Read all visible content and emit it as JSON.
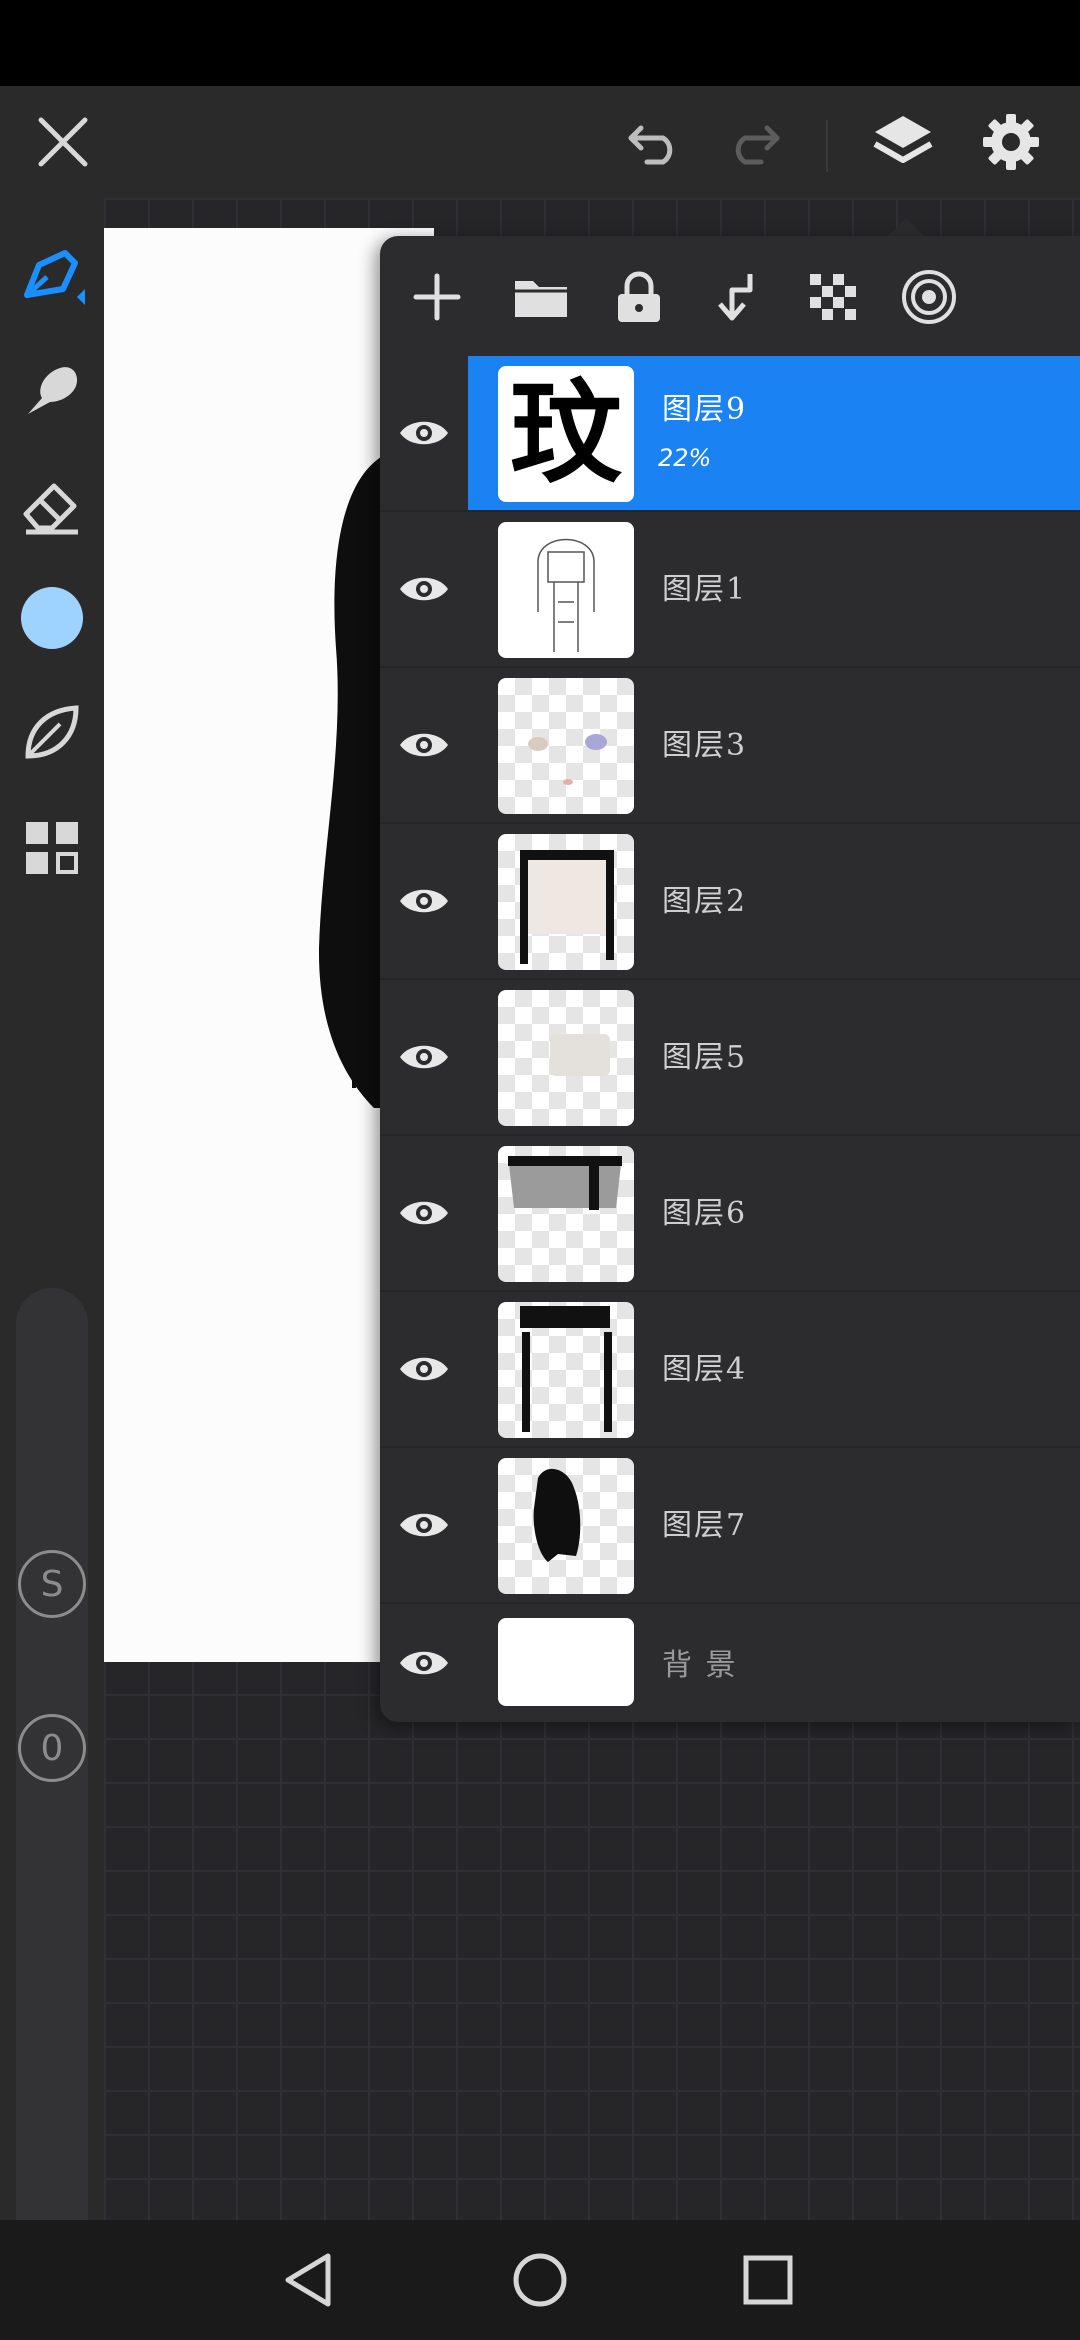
{
  "app": {
    "accent": "#1a82f2",
    "brush_color": "#9fd3ff"
  },
  "top_bar": {
    "icons": [
      "close-icon",
      "undo-icon",
      "redo-icon",
      "layers-icon",
      "settings-icon"
    ]
  },
  "left_toolbar": {
    "tools": [
      "brush-icon",
      "smudge-icon",
      "eraser-icon",
      "color-swatch",
      "leaf-icon",
      "gallery-grid-icon"
    ],
    "size_slider_label": "S",
    "opacity_slider_label": "0"
  },
  "layers_panel": {
    "toolbar_icons": [
      "add-icon",
      "folder-icon",
      "lock-icon",
      "merge-down-icon",
      "checkerboard-icon",
      "target-icon"
    ],
    "layers": [
      {
        "name": "图层9",
        "opacity": "22%",
        "selected": true,
        "visible": true
      },
      {
        "name": "图层1",
        "selected": false,
        "visible": true
      },
      {
        "name": "图层3",
        "selected": false,
        "visible": true
      },
      {
        "name": "图层2",
        "selected": false,
        "visible": true
      },
      {
        "name": "图层5",
        "selected": false,
        "visible": true
      },
      {
        "name": "图层6",
        "selected": false,
        "visible": true
      },
      {
        "name": "图层4",
        "selected": false,
        "visible": true
      },
      {
        "name": "图层7",
        "selected": false,
        "visible": true
      },
      {
        "name": "背 景",
        "selected": false,
        "visible": true
      }
    ],
    "layer9_thumb_text": "玟"
  },
  "nav_bar": {
    "icons": [
      "back-icon",
      "home-icon",
      "recents-icon"
    ]
  }
}
